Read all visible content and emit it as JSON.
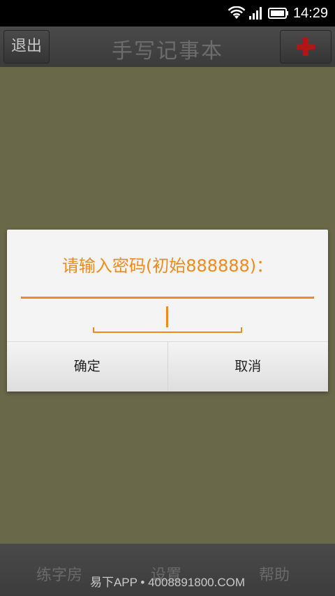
{
  "status_bar": {
    "time": "14:29",
    "icons": [
      "wifi-icon",
      "signal-icon",
      "battery-icon"
    ]
  },
  "title_bar": {
    "exit_label": "退出",
    "title": "手写记事本",
    "add_icon": "plus-icon",
    "add_color": "#b01616"
  },
  "dialog": {
    "title": "请输入密码(初始888888)：",
    "password_value": "",
    "confirm_label": "确定",
    "cancel_label": "取消",
    "accent_color": "#f08a1c"
  },
  "bottom_nav": {
    "items": [
      {
        "label": "练字房"
      },
      {
        "label": "设置"
      },
      {
        "label": "帮助"
      }
    ]
  },
  "watermark": "易下APP • 4008891800.COM"
}
